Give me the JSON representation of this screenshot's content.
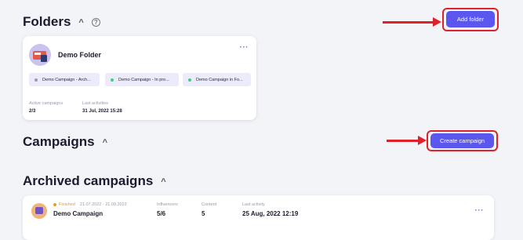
{
  "folders_section": {
    "title": "Folders",
    "chevron_icon": "chevron-up-icon",
    "help_icon": "question-circle-icon",
    "help_glyph": "?",
    "add_button_label": "Add folder"
  },
  "folder_card": {
    "name": "Demo Folder",
    "menu_glyph": "···",
    "chips": [
      {
        "label": "Demo Campaign - Arch...",
        "dot_color": "#9a9aab"
      },
      {
        "label": "Demo Campaign - In pro...",
        "dot_color": "#3ccf7a"
      },
      {
        "label": "Demo Campaign in Fo...",
        "dot_color": "#3ccf7a"
      }
    ],
    "active_campaigns_label": "Active campaigns",
    "active_campaigns_value": "2/3",
    "last_activities_label": "Last activities",
    "last_activities_value": "31 Jul, 2022 15:28"
  },
  "campaigns_section": {
    "title": "Campaigns",
    "chevron_icon": "chevron-up-icon",
    "create_button_label": "Create campaign"
  },
  "archived_section": {
    "title": "Archived campaigns",
    "chevron_icon": "chevron-up-icon",
    "campaign": {
      "status": "Finished",
      "status_color": "#f19a1f",
      "dates": "21.07.2022 - 21.09.2022",
      "name": "Demo Campaign",
      "influencers_label": "Influencers",
      "influencers_value": "5/6",
      "content_label": "Content",
      "content_value": "5",
      "last_activity_label": "Last activity",
      "last_activity_value": "25 Aug, 2022 12:19",
      "menu_glyph": "···"
    }
  },
  "colors": {
    "accent": "#5b57ee",
    "highlight": "#e0212a",
    "background": "#f3f4f8"
  }
}
